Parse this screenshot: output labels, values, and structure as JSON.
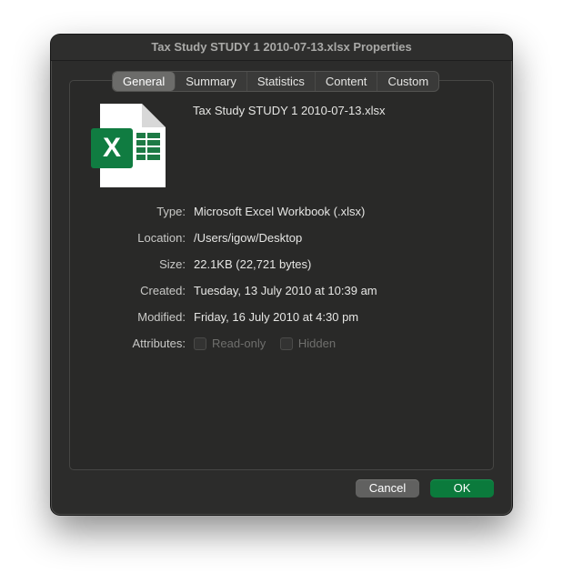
{
  "window": {
    "title": "Tax Study STUDY 1 2010-07-13.xlsx Properties"
  },
  "tabs": [
    {
      "label": "General",
      "active": true
    },
    {
      "label": "Summary",
      "active": false
    },
    {
      "label": "Statistics",
      "active": false
    },
    {
      "label": "Content",
      "active": false
    },
    {
      "label": "Custom",
      "active": false
    }
  ],
  "file": {
    "name": "Tax Study STUDY 1 2010-07-13.xlsx",
    "icon": "excel-file-icon",
    "icon_letter": "X",
    "icon_color": "#107c41"
  },
  "properties": {
    "type": {
      "label": "Type:",
      "value": "Microsoft Excel Workbook (.xlsx)"
    },
    "location": {
      "label": "Location:",
      "value": "/Users/igow/Desktop"
    },
    "size": {
      "label": "Size:",
      "value": "22.1KB (22,721 bytes)"
    },
    "created": {
      "label": "Created:",
      "value": "Tuesday, 13 July 2010 at 10:39 am"
    },
    "modified": {
      "label": "Modified:",
      "value": "Friday, 16 July 2010 at 4:30 pm"
    },
    "attributes": {
      "label": "Attributes:",
      "read_only": {
        "label": "Read-only",
        "checked": false,
        "enabled": false
      },
      "hidden": {
        "label": "Hidden",
        "checked": false,
        "enabled": false
      }
    }
  },
  "buttons": {
    "cancel": "Cancel",
    "ok": "OK"
  },
  "colors": {
    "accent": "#0b7a3c",
    "window_bg": "#2c2c2b"
  }
}
